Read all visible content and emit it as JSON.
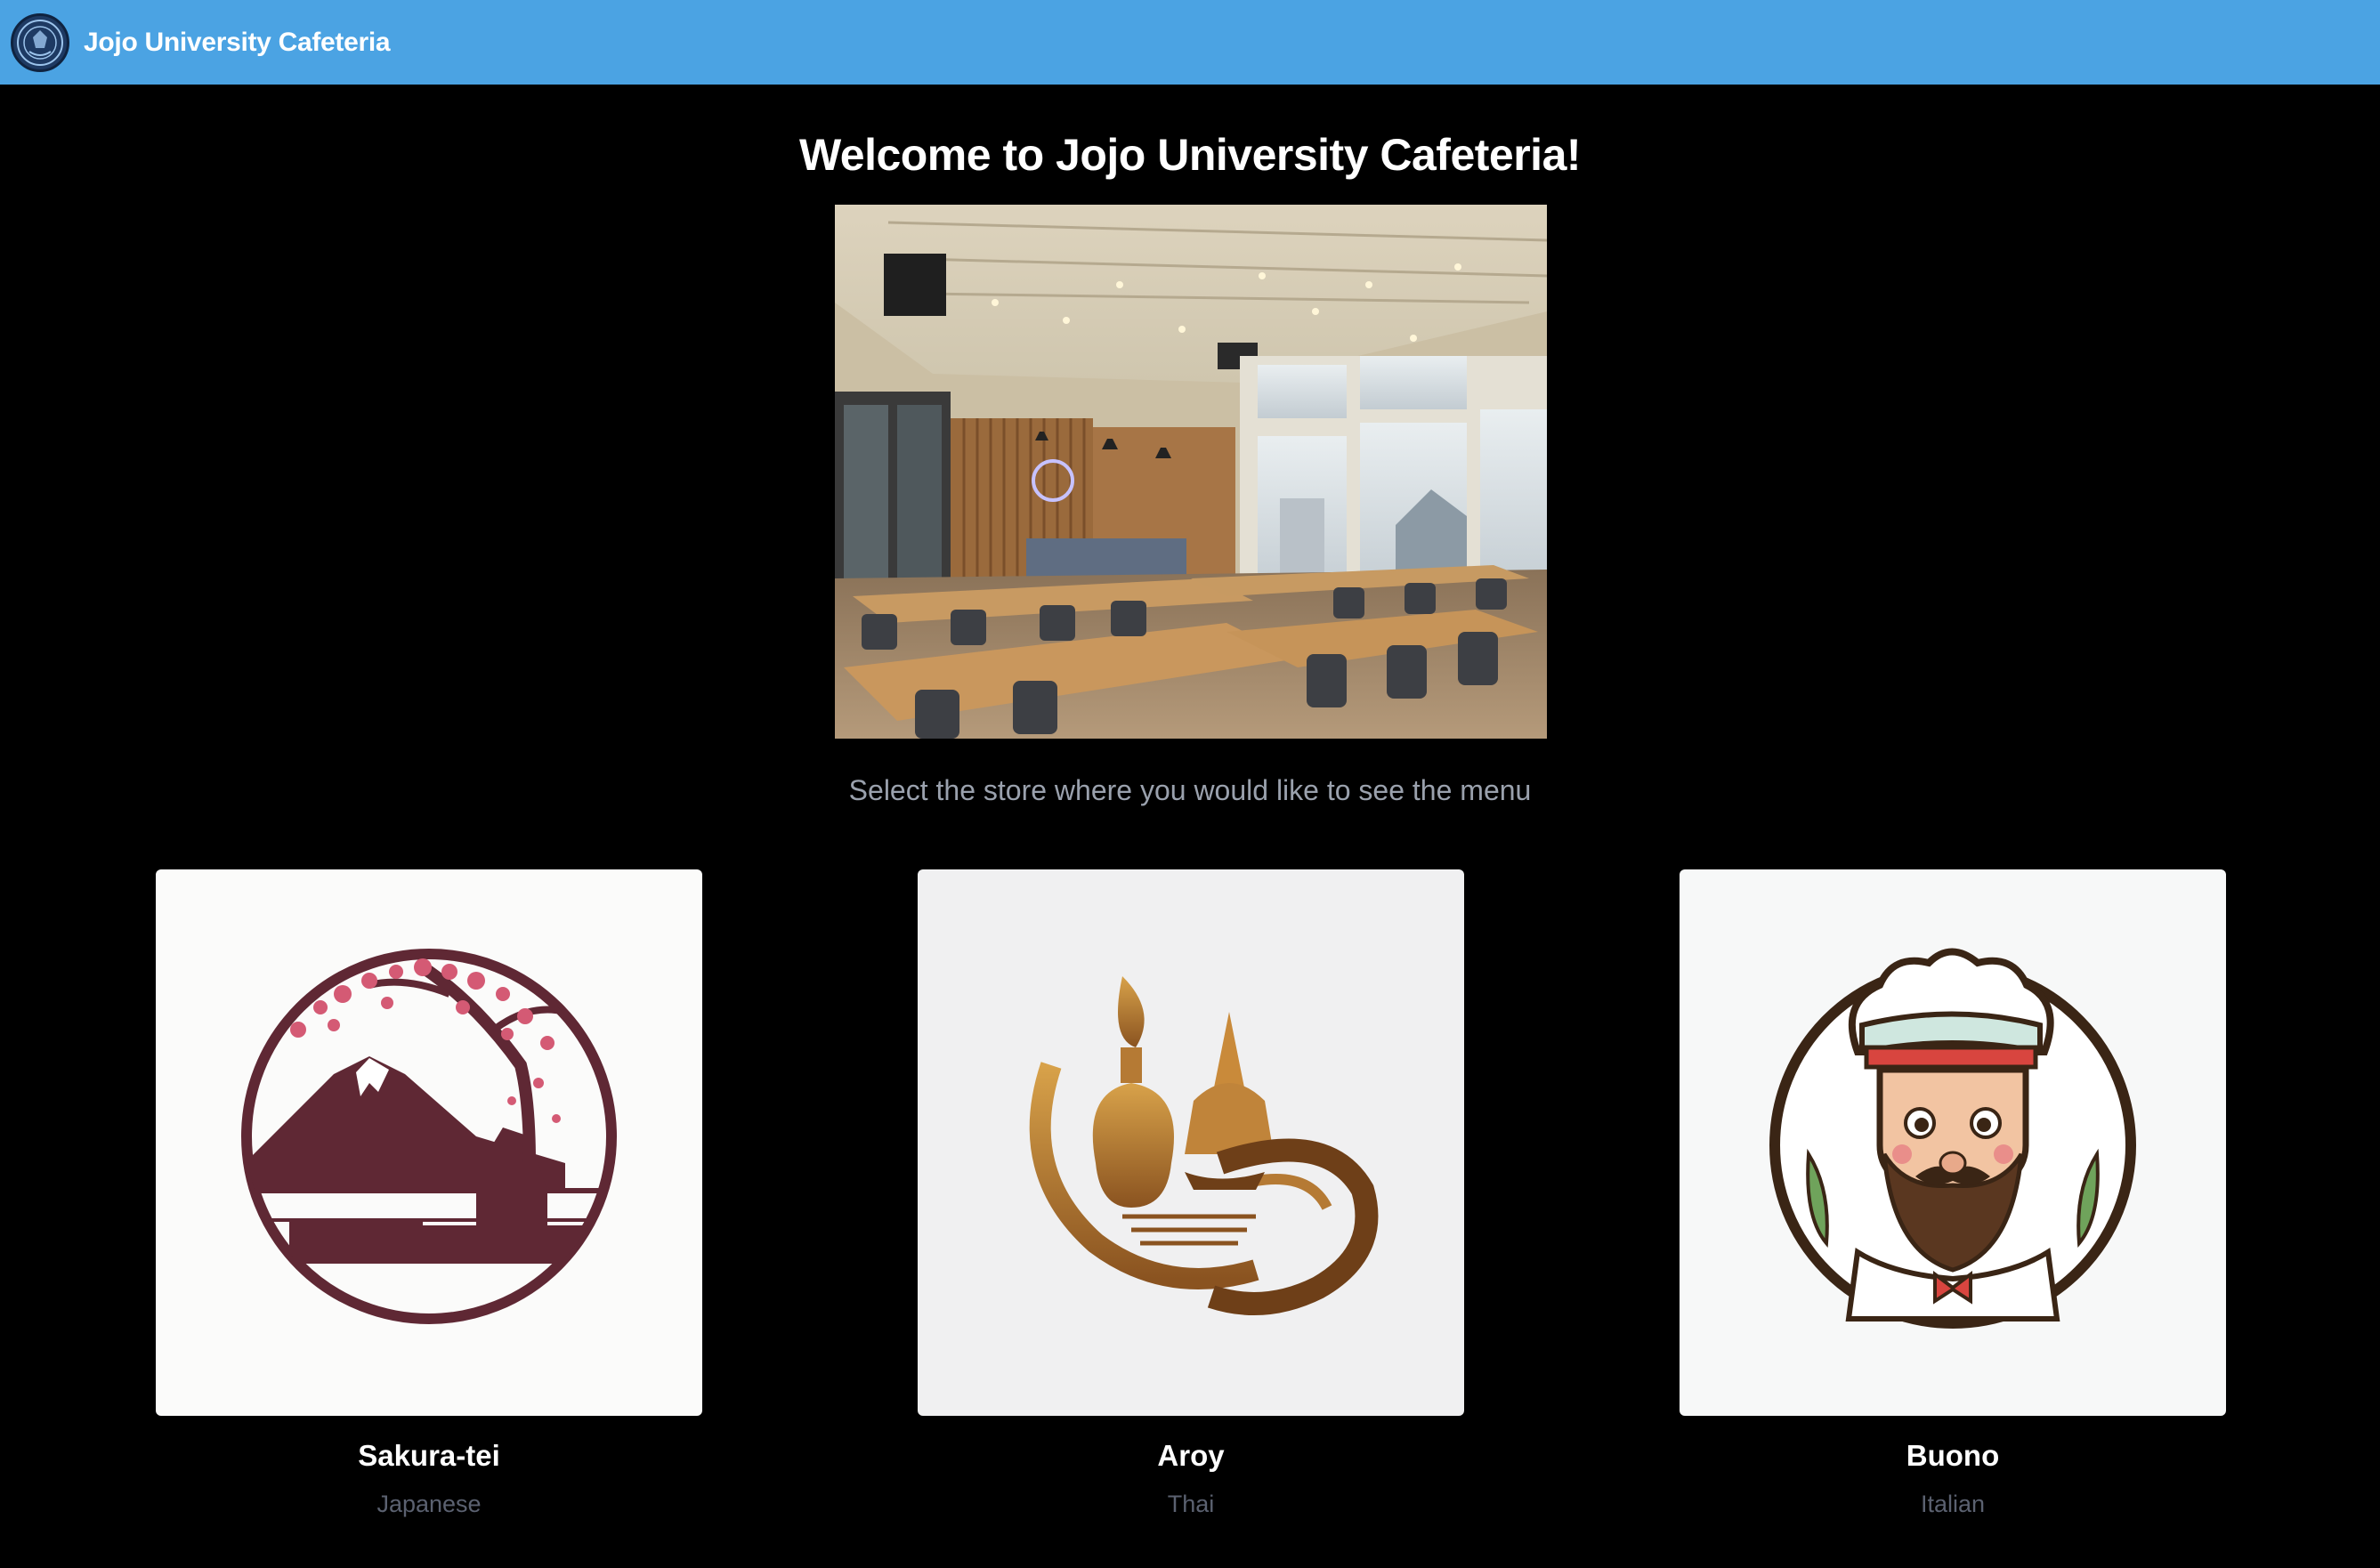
{
  "app": {
    "title": "Jojo University Cafeteria",
    "brand_color": "#4ba3e3",
    "logo_icon": "university-crest-icon"
  },
  "main": {
    "heading": "Welcome to Jojo University Cafeteria!",
    "hero_image": "cafeteria-interior-photo",
    "subtitle": "Select the store where you would like to see the menu"
  },
  "stores": [
    {
      "name": "Sakura-tei",
      "cuisine": "Japanese",
      "logo": "sakura-mount-fuji-logo"
    },
    {
      "name": "Aroy",
      "cuisine": "Thai",
      "logo": "thai-temple-flame-logo"
    },
    {
      "name": "Buono",
      "cuisine": "Italian",
      "logo": "chef-mustache-logo"
    }
  ]
}
